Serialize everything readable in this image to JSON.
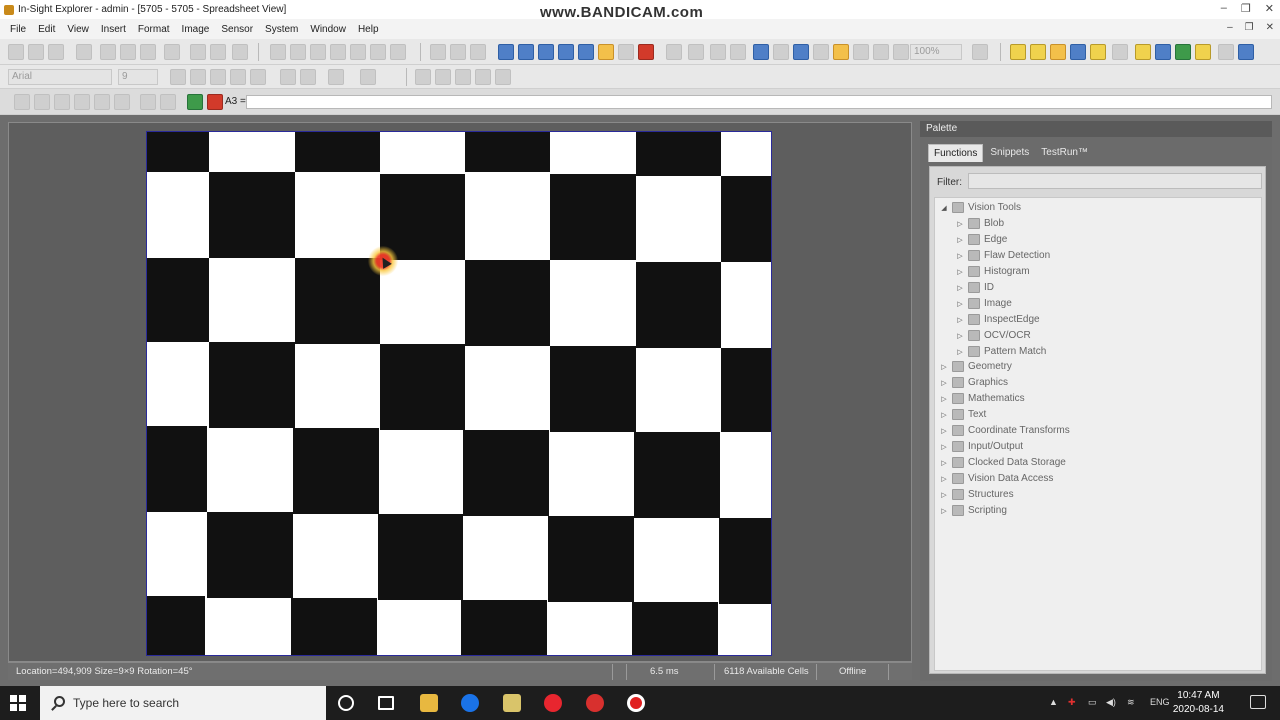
{
  "window": {
    "title": "In-Sight Explorer - admin - [5705 - 5705 - Spreadsheet View]",
    "watermark": "www.BANDICAM.com",
    "controls": [
      "–",
      "❐",
      "✕"
    ]
  },
  "menu": {
    "items": [
      "File",
      "Edit",
      "View",
      "Insert",
      "Format",
      "Image",
      "Sensor",
      "System",
      "Window",
      "Help"
    ],
    "doc_controls": [
      "–",
      "❐",
      "✕"
    ]
  },
  "toolbar": {
    "font_name": "Arial",
    "font_size": "9",
    "zoom_level": "100%"
  },
  "formula_bar": {
    "cell_ref": "A3 =",
    "value": ""
  },
  "status": {
    "location": "Location=494,909 Size=9×9 Rotation=45°",
    "time": "6.5 ms",
    "cells": "6118 Available Cells",
    "mode": "Offline"
  },
  "palette": {
    "title": "Palette",
    "tabs": [
      "Functions",
      "Snippets",
      "TestRun™"
    ],
    "filter_label": "Filter:",
    "filter_value": "",
    "tree": [
      {
        "label": "Vision Tools",
        "expanded": true,
        "children": [
          "Blob",
          "Edge",
          "Flaw Detection",
          "Histogram",
          "ID",
          "Image",
          "InspectEdge",
          "OCV/OCR",
          "Pattern Match"
        ]
      },
      {
        "label": "Geometry"
      },
      {
        "label": "Graphics"
      },
      {
        "label": "Mathematics"
      },
      {
        "label": "Text"
      },
      {
        "label": "Coordinate Transforms"
      },
      {
        "label": "Input/Output"
      },
      {
        "label": "Clocked Data Storage"
      },
      {
        "label": "Vision Data Access"
      },
      {
        "label": "Structures"
      },
      {
        "label": "Scripting"
      }
    ]
  },
  "taskbar": {
    "search_placeholder": "Type here to search",
    "language": "ENG",
    "time": "10:47 AM",
    "date": "2020-08-14"
  },
  "colors": {
    "accent": "#4f7fc7",
    "taskbar_bg": "#1d1d1d"
  }
}
